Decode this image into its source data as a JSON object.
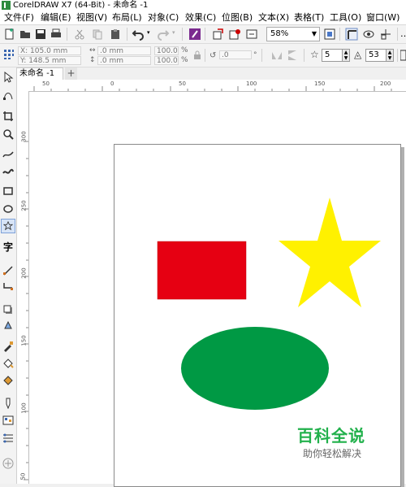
{
  "window": {
    "title": "CorelDRAW X7 (64-Bit) - 未命名 -1"
  },
  "menu": [
    "文件(F)",
    "编辑(E)",
    "视图(V)",
    "布局(L)",
    "对象(C)",
    "效果(C)",
    "位图(B)",
    "文本(X)",
    "表格(T)",
    "工具(O)",
    "窗口(W)"
  ],
  "toolbar": {
    "zoom_value": "58%"
  },
  "properties": {
    "x": "X: 105.0 mm",
    "y": "Y: 148.5 mm",
    "width": ".0 mm",
    "height": ".0 mm",
    "scale_w": "100.0",
    "scale_h": "100.0",
    "percent": "%",
    "rotation": ".0",
    "star_points": "5",
    "star_sharpness": "53"
  },
  "tabs": {
    "document": "未命名 -1",
    "add": "+"
  },
  "ruler": {
    "h_labels": [
      "50",
      "0",
      "50",
      "100",
      "150",
      "200"
    ],
    "v_labels": [
      "300",
      "250",
      "200",
      "150",
      "100",
      "50"
    ]
  },
  "shapes": {
    "rectangle_color": "#e60012",
    "star_color": "#fff100",
    "ellipse_color": "#009944"
  },
  "watermark": {
    "main": "百科全说",
    "sub": "助你轻松解决"
  },
  "colors": {
    "accent_green": "#22b14c"
  }
}
